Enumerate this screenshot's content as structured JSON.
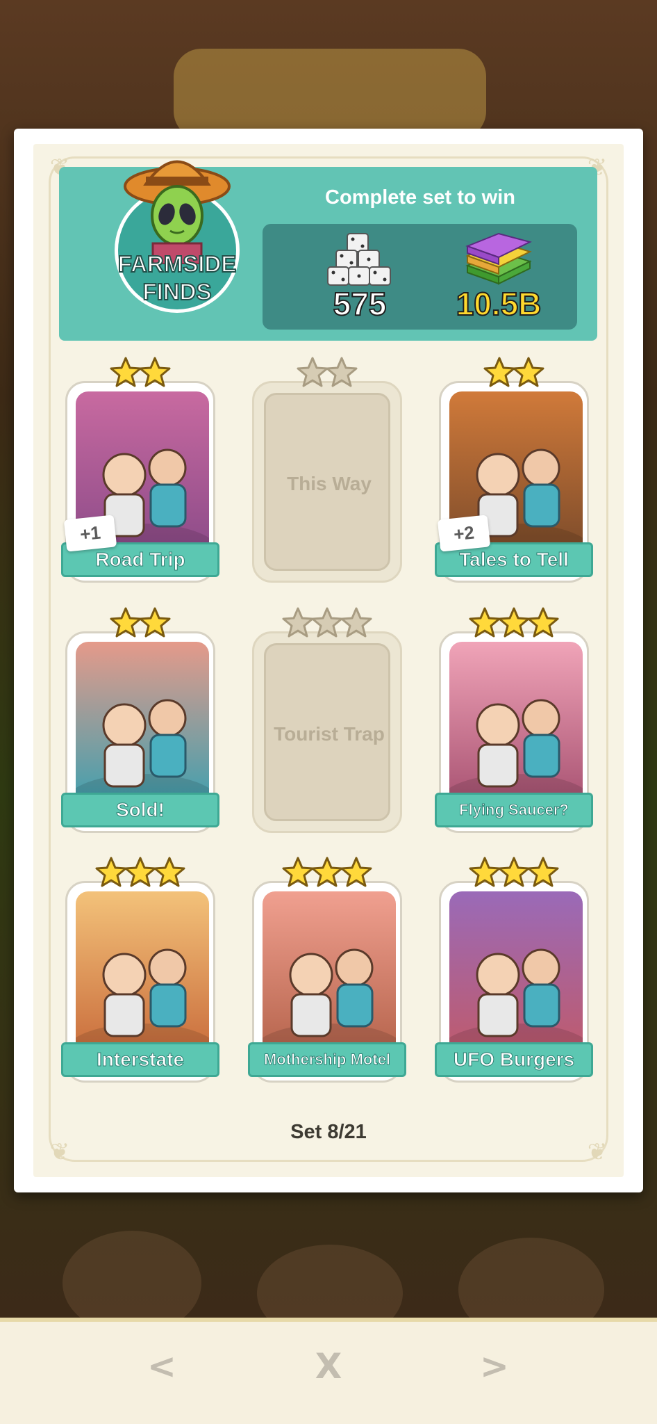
{
  "header": {
    "title": "Complete set to win",
    "set_name_line1": "FARMSIDE",
    "set_name_line2": "FINDS",
    "rewards": {
      "dice": "575",
      "cash": "10.5B"
    }
  },
  "cards": [
    {
      "title": "Road Trip",
      "stars": 2,
      "collected": true,
      "extra": "+1"
    },
    {
      "title": "This Way",
      "stars": 2,
      "collected": false,
      "extra": ""
    },
    {
      "title": "Tales to Tell",
      "stars": 2,
      "collected": true,
      "extra": "+2"
    },
    {
      "title": "Sold!",
      "stars": 2,
      "collected": true,
      "extra": ""
    },
    {
      "title": "Tourist Trap",
      "stars": 3,
      "collected": false,
      "extra": ""
    },
    {
      "title": "Flying Saucer?",
      "stars": 3,
      "collected": true,
      "extra": ""
    },
    {
      "title": "Interstate",
      "stars": 3,
      "collected": true,
      "extra": ""
    },
    {
      "title": "Mothership Motel",
      "stars": 3,
      "collected": true,
      "extra": ""
    },
    {
      "title": "UFO Burgers",
      "stars": 3,
      "collected": true,
      "extra": ""
    }
  ],
  "progress": "Set 8/21",
  "nav": {
    "prev": "<",
    "close": "X",
    "next": ">"
  },
  "colors": {
    "accent_teal": "#5cc7b2",
    "header_teal": "#62c4b4",
    "reward_box": "#3e8b85",
    "star_gold": "#ffd93b",
    "star_locked": "#d6ccb4"
  }
}
